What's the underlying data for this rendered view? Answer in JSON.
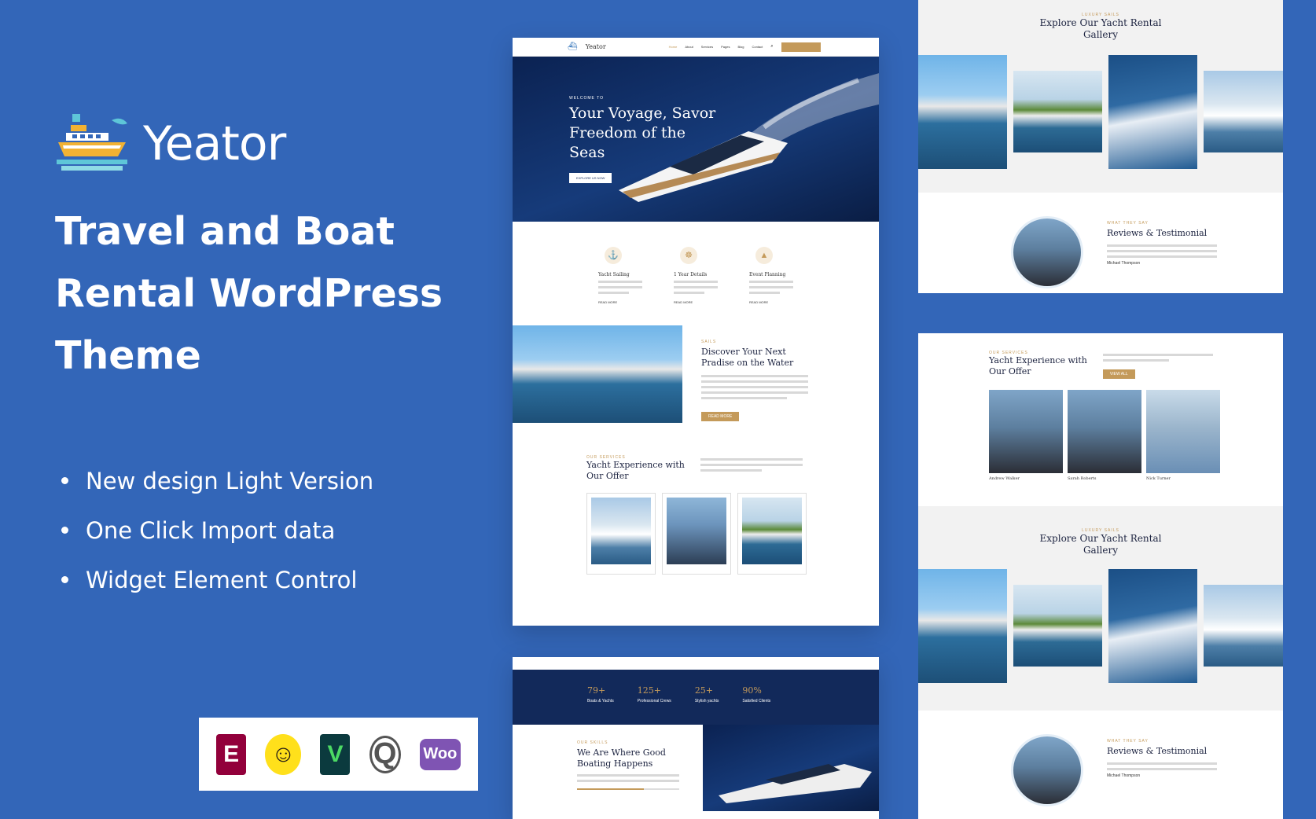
{
  "brand": {
    "name": "Yeator"
  },
  "headline": {
    "lines": [
      "Travel and Boat",
      "Rental WordPress",
      "Theme"
    ]
  },
  "features": [
    "New design Light Version",
    "One Click Import data",
    "Widget Element Control"
  ],
  "plugins": [
    {
      "icon": "elementor-icon",
      "glyph": "E",
      "color": "#92003b"
    },
    {
      "icon": "mailchimp-icon",
      "glyph": "☺",
      "color": "#ffe01b"
    },
    {
      "icon": "visual-composer-icon",
      "glyph": "V",
      "color": "#0b3a3e"
    },
    {
      "icon": "quform-icon",
      "glyph": "Q",
      "color": "#555555"
    },
    {
      "icon": "woocommerce-icon",
      "glyph": "Woo",
      "color": "#7f54b3"
    }
  ],
  "preview_main": {
    "logo": "Yeator",
    "nav": [
      "Home",
      "About",
      "Services",
      "Pages",
      "Blog",
      "Contact"
    ],
    "hero": {
      "eyebrow": "WELCOME TO",
      "title_lines": [
        "Your Voyage, Savor",
        "Freedom of the",
        "Seas"
      ],
      "button": "EXPLORE US NOW"
    },
    "services": [
      {
        "title": "Yacht Sailing",
        "link": "READ MORE"
      },
      {
        "title": "1 Year Details",
        "link": "READ MORE"
      },
      {
        "title": "Event Planning",
        "link": "READ MORE"
      }
    ],
    "discover": {
      "eyebrow": "SAILS",
      "title_lines": [
        "Discover Your Next",
        "Pradise on the Water"
      ],
      "button": "READ MORE"
    },
    "offer": {
      "eyebrow": "OUR SERVICES",
      "title_lines": [
        "Yacht Experience with",
        "Our Offer"
      ]
    }
  },
  "preview_stats": {
    "stats": [
      {
        "value": "79+",
        "label": "Boats & Yachts"
      },
      {
        "value": "125+",
        "label": "Professional Crews"
      },
      {
        "value": "25+",
        "label": "Stylish yachts"
      },
      {
        "value": "90%",
        "label": "Satisfied Clients"
      }
    ],
    "eyebrow": "OUR SKILLS",
    "title_lines": [
      "We Are Where Good",
      "Boating Happens"
    ]
  },
  "preview_gallery": {
    "eyebrow": "LUXURY SAILS",
    "title_lines": [
      "Explore Our Yacht Rental",
      "Gallery"
    ],
    "reviews_eyebrow": "WHAT THEY SAY",
    "reviews_title": "Reviews & Testimonial",
    "reviewer": "Michael Thompson"
  },
  "preview_team": {
    "eyebrow": "OUR SERVICES",
    "title_lines": [
      "Yacht Experience with",
      "Our Offer"
    ],
    "button": "VIEW ALL",
    "members": [
      {
        "name": "Andrew Walker"
      },
      {
        "name": "Sarah Roberts"
      },
      {
        "name": "Nick Turner"
      }
    ]
  }
}
